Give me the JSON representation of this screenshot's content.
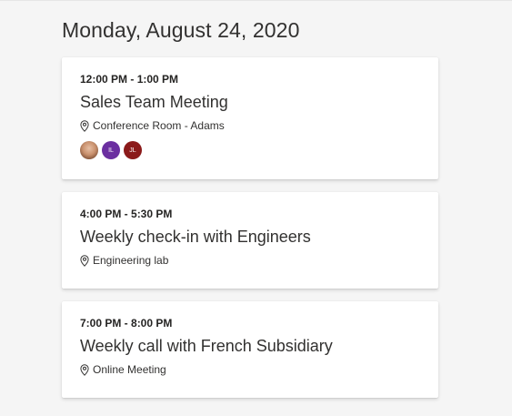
{
  "agenda": {
    "date_heading": "Monday, August 24, 2020",
    "events": [
      {
        "time": "12:00 PM - 1:00 PM",
        "title": "Sales Team Meeting",
        "location": "Conference Room - Adams",
        "location_icon": "map-pin-icon",
        "attendees": [
          {
            "type": "photo",
            "initials": ""
          },
          {
            "type": "initials",
            "initials": "IL",
            "color": "#6b2fa0"
          },
          {
            "type": "initials",
            "initials": "JL",
            "color": "#8b1a1a"
          }
        ]
      },
      {
        "time": "4:00 PM - 5:30 PM",
        "title": "Weekly check-in with Engineers",
        "location": "Engineering lab",
        "location_icon": "map-pin-icon"
      },
      {
        "time": "7:00 PM - 8:00 PM",
        "title": "Weekly call with French Subsidiary",
        "location": "Online Meeting",
        "location_icon": "map-pin-icon"
      }
    ]
  }
}
